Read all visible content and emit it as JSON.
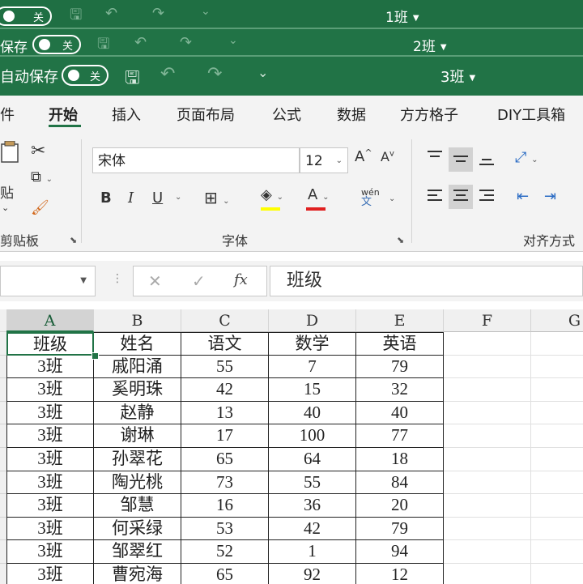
{
  "windows": [
    {
      "autosave_label": "",
      "toggle_text": "关",
      "title": "1班"
    },
    {
      "autosave_label": "保存",
      "toggle_text": "关",
      "title": "2班"
    },
    {
      "autosave_label": "自动保存",
      "toggle_text": "关",
      "title": "3班"
    }
  ],
  "ribbon_tabs": [
    "件",
    "开始",
    "插入",
    "页面布局",
    "公式",
    "数据",
    "方方格子",
    "DIY工具箱"
  ],
  "active_tab": "开始",
  "clipboard": {
    "paste_label": "贴",
    "group_label": "剪贴板"
  },
  "font": {
    "name": "宋体",
    "size": "12",
    "group_label": "字体",
    "bold": "B",
    "italic": "I",
    "underline": "U",
    "wen": "wén",
    "wen_char": "文"
  },
  "alignment": {
    "group_label": "对齐方式"
  },
  "formula_bar": {
    "content": "班级",
    "fx": "fx"
  },
  "columns": [
    "A",
    "B",
    "C",
    "D",
    "E",
    "F",
    "G"
  ],
  "headers": [
    "班级",
    "姓名",
    "语文",
    "数学",
    "英语"
  ],
  "rows": [
    [
      "3班",
      "戚阳涌",
      "55",
      "7",
      "79"
    ],
    [
      "3班",
      "奚明珠",
      "42",
      "15",
      "32"
    ],
    [
      "3班",
      "赵静",
      "13",
      "40",
      "40"
    ],
    [
      "3班",
      "谢琳",
      "17",
      "100",
      "77"
    ],
    [
      "3班",
      "孙翠花",
      "65",
      "64",
      "18"
    ],
    [
      "3班",
      "陶光桃",
      "73",
      "55",
      "84"
    ],
    [
      "3班",
      "邹慧",
      "16",
      "36",
      "20"
    ],
    [
      "3班",
      "何采绿",
      "53",
      "42",
      "79"
    ],
    [
      "3班",
      "邹翠红",
      "52",
      "1",
      "94"
    ],
    [
      "3班",
      "曹宛海",
      "65",
      "92",
      "12"
    ]
  ],
  "colors": {
    "excel_green": "#217346",
    "font_color": "#e02020",
    "highlight": "#ffff00"
  }
}
